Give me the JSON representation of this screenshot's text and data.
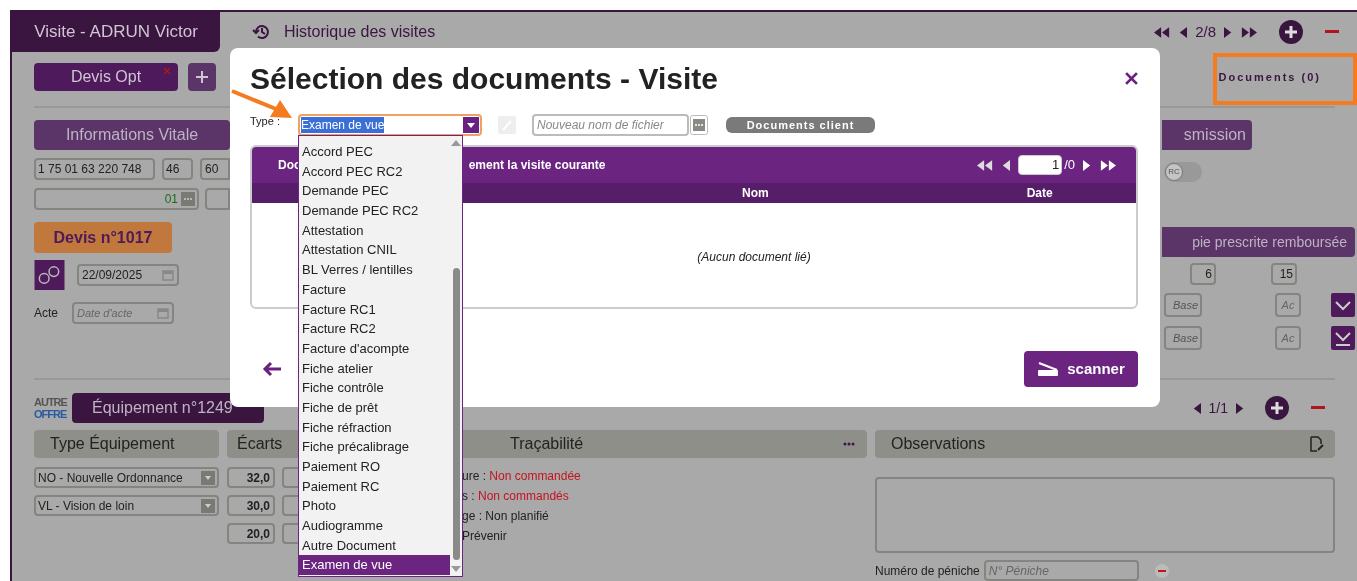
{
  "header": {
    "visit_tab": "Visite - ADRUN Victor",
    "history_link": "Historique des visites",
    "pager": "2/8"
  },
  "quote_tab": {
    "label": "Devis Opt"
  },
  "documents_button": "Documents (0)",
  "vitale": {
    "title": "Informations Vitale",
    "ss_number": "1 75 01 63 220 748",
    "age": "46",
    "rate": "60",
    "code": "01"
  },
  "quote": {
    "title": "Devis n°1017",
    "date": "22/09/2025",
    "act_label": "Acte",
    "act_placeholder": "Date d'acte"
  },
  "transmission": {
    "title": "smission",
    "rc_toggle": {
      "label": "RC",
      "on": false
    }
  },
  "prescription": {
    "title": "pie prescrite remboursée",
    "values": [
      "6",
      "15"
    ],
    "rows": [
      {
        "base_placeholder": "Base",
        "ac_placeholder": "Ac",
        "kind": "expand"
      },
      {
        "base_placeholder": "Base",
        "ac_placeholder": "Ac",
        "kind": "download"
      }
    ]
  },
  "equipment": {
    "offer_logo": {
      "line1": "AUTRE",
      "line2": "OFFRE"
    },
    "tab": "Équipement n°1249",
    "pager": "1/1",
    "columns": [
      "Type Équipement",
      "Écarts",
      "Traçabilité",
      "Observations"
    ],
    "types": [
      "NO - Nouvelle Ordonnance",
      "VL - Vision de loin"
    ],
    "gaps": [
      "32,0",
      "30,0",
      "20,0"
    ],
    "traceability": [
      {
        "label": "ure :",
        "value": "Non commandée",
        "alert": true
      },
      {
        "label": "s :",
        "value": "Non commandés",
        "alert": true
      },
      {
        "label": "ge :",
        "value": "Non planifié",
        "alert": false
      },
      {
        "label": "Prévenir"
      }
    ],
    "barge_label": "Numéro de péniche",
    "barge_placeholder": "N° Péniche"
  },
  "modal": {
    "title": "Sélection des documents - Visite",
    "type_label": "Type :",
    "type_value": "Examen de vue",
    "filename_placeholder": "Nouveau nom de fichier",
    "client_docs_button": "Documents client",
    "table": {
      "caption_start": "Doc",
      "caption_end": "ement la visite courante",
      "page": "1",
      "page_total": "/0",
      "columns": [
        "Nom",
        "Date"
      ],
      "empty": "(Aucun document lié)"
    },
    "scan_button": "scanner"
  },
  "type_options": [
    {
      "label": "Accord PEC",
      "selected": false
    },
    {
      "label": "Accord PEC RC2",
      "selected": false
    },
    {
      "label": "Demande PEC",
      "selected": false
    },
    {
      "label": "Demande PEC RC2",
      "selected": false
    },
    {
      "label": "Attestation",
      "selected": false
    },
    {
      "label": "Attestation CNIL",
      "selected": false
    },
    {
      "label": "BL Verres / lentilles",
      "selected": false
    },
    {
      "label": "Facture",
      "selected": false
    },
    {
      "label": "Facture RC1",
      "selected": false
    },
    {
      "label": "Facture RC2",
      "selected": false
    },
    {
      "label": "Facture d'acompte",
      "selected": false
    },
    {
      "label": "Fiche atelier",
      "selected": false
    },
    {
      "label": "Fiche contrôle",
      "selected": false
    },
    {
      "label": "Fiche de prêt",
      "selected": false
    },
    {
      "label": "Fiche réfraction",
      "selected": false
    },
    {
      "label": "Fiche précalibrage",
      "selected": false
    },
    {
      "label": "Paiement RO",
      "selected": false
    },
    {
      "label": "Paiement RC",
      "selected": false
    },
    {
      "label": "Photo",
      "selected": false
    },
    {
      "label": "Audiogramme",
      "selected": false
    },
    {
      "label": "Autre Document",
      "selected": false
    },
    {
      "label": "Examen de vue",
      "selected": true
    }
  ]
}
